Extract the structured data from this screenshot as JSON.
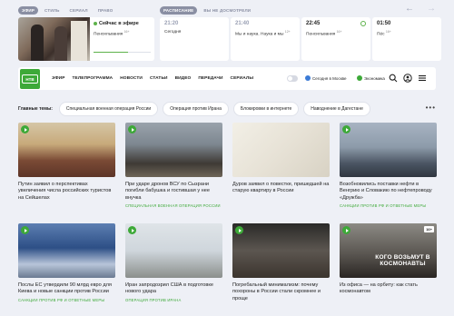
{
  "top": {
    "pills_left": [
      "ЭФИР",
      "СТИЛЬ",
      "СЕРИАЛ",
      "ПРАВО"
    ],
    "pills_right": [
      "РАСПИСАНИЕ",
      "ВЫ НЕ ДОСМОТРЕЛИ"
    ],
    "arrow_prev": "←",
    "arrow_next": "→"
  },
  "live": {
    "title": "Сейчас в эфире",
    "program": "Пенсильвания",
    "age": "16+"
  },
  "schedule": [
    {
      "time": "21:20",
      "name": "Сегодня",
      "age": ""
    },
    {
      "time": "21:40",
      "name": "Мы и наука. Наука и мы",
      "age": "12+"
    },
    {
      "time": "22:45",
      "name": "Пенсильвания",
      "age": "16+"
    },
    {
      "time": "01:50",
      "name": "Пёс",
      "age": "16+"
    }
  ],
  "nav": {
    "logo": "НТВ",
    "links": [
      "ЭФИР",
      "ТЕЛЕПРОГРАММА",
      "НОВОСТИ",
      "СТАТЬИ",
      "ВИДЕО",
      "ПЕРЕДАЧИ",
      "СЕРИАЛЫ"
    ],
    "weather": "Сегодня в Москве",
    "economy": "Экономика",
    "icons": [
      "search-icon",
      "user-icon",
      "menu-icon"
    ]
  },
  "topics": {
    "label": "Главные темы:",
    "items": [
      "Специальная военная операция России",
      "Операция против Ирана",
      "Блокировки в интернете",
      "Наводнение в Дагестане"
    ],
    "more": "•••"
  },
  "cards": [
    {
      "title": "Путин заявил о перспективах увеличения числа российских туристов на Сейшелах",
      "tag": ""
    },
    {
      "title": "При ударе дронов ВСУ по Сызрани погибли бабушка и гостившая у нее внучка",
      "tag": "СПЕЦИАЛЬНАЯ ВОЕННАЯ ОПЕРАЦИЯ РОССИИ"
    },
    {
      "title": "Дуров заявил о повестке, пришедшей на старую квартиру в России",
      "tag": ""
    },
    {
      "title": "Возобновились поставки нефти в Венгрию и Словакию по нефтепроводу «Дружба»",
      "tag": "САНКЦИИ ПРОТИВ РФ И ОТВЕТНЫЕ МЕРЫ"
    },
    {
      "title": "Послы ЕС утвердили 90 млрд евро для Киева и новые санкции против России",
      "tag": "САНКЦИИ ПРОТИВ РФ И ОТВЕТНЫЕ МЕРЫ"
    },
    {
      "title": "Иран запродозрил США в подготовке нового удара",
      "tag": "ОПЕРАЦИЯ ПРОТИВ ИРАНА"
    },
    {
      "title": "Погребальный минимализм: почему похороны в России стали скромнее и проще",
      "tag": ""
    },
    {
      "title": "Из офиса — на орбиту: как стать космонавтом",
      "tag": "",
      "overlay": "КОГО ВОЗЬМУТ В КОСМОНАВТЫ",
      "age": "16+"
    }
  ],
  "colors": {
    "accent": "#3da938",
    "background": "#eef0f6"
  }
}
